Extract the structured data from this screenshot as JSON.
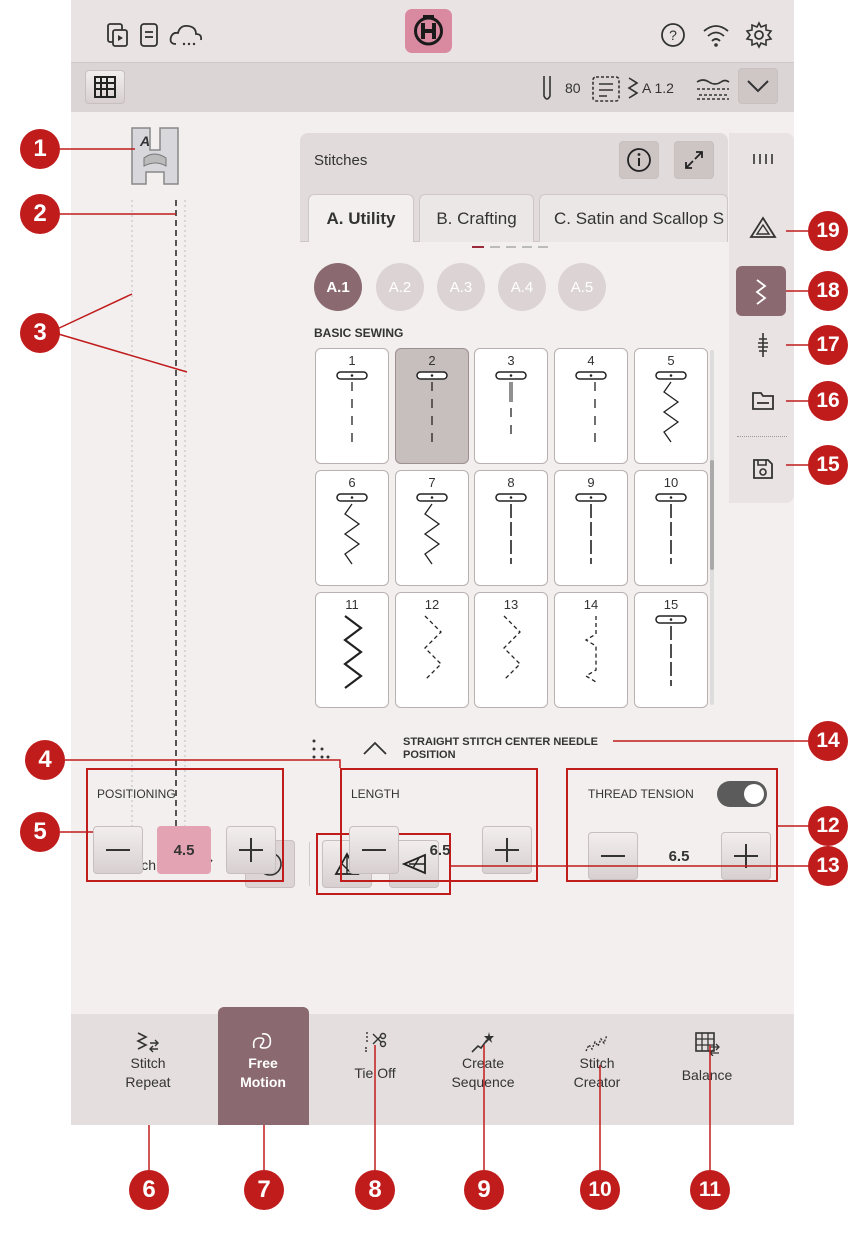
{
  "topbar": {
    "icons": [
      "sequence-icon",
      "guide-icon",
      "cloud-icon",
      "husqvarna-logo",
      "help-icon",
      "wifi-icon",
      "settings-icon"
    ]
  },
  "subbar": {
    "needle_value": "80",
    "stitch_code": "A 1.2"
  },
  "stitch_panel": {
    "title": "Stitches",
    "tabs": [
      "A. Utility",
      "B. Crafting",
      "C. Satin and Scallop S"
    ],
    "subcategories": [
      "A.1",
      "A.2",
      "A.3",
      "A.4",
      "A.5"
    ],
    "section_label": "BASIC SEWING",
    "stitches": [
      "1",
      "2",
      "3",
      "4",
      "5",
      "6",
      "7",
      "8",
      "9",
      "10",
      "11",
      "12",
      "13",
      "14",
      "15"
    ],
    "selected_stitch": "2",
    "description": "STRAIGHT STITCH CENTER NEEDLE POSITION"
  },
  "edit": {
    "label": "Edit Stitch"
  },
  "positioning": {
    "label": "POSITIONING",
    "value": "4.5"
  },
  "length": {
    "label": "LENGTH",
    "value": "6.5"
  },
  "thread_tension": {
    "label": "THREAD TENSION",
    "value": "6.5",
    "enabled": true
  },
  "bottom_bar": [
    {
      "l1": "Stitch",
      "l2": "Repeat"
    },
    {
      "l1": "Free",
      "l2": "Motion"
    },
    {
      "l1": "Tie Off",
      "l2": ""
    },
    {
      "l1": "Create",
      "l2": "Sequence"
    },
    {
      "l1": "Stitch",
      "l2": "Creator"
    },
    {
      "l1": "Balance",
      "l2": ""
    }
  ],
  "callouts": [
    "1",
    "2",
    "3",
    "4",
    "5",
    "6",
    "7",
    "8",
    "9",
    "10",
    "11",
    "12",
    "13",
    "14",
    "15",
    "16",
    "17",
    "18",
    "19"
  ],
  "colors": {
    "accent": "#c01c1c",
    "active": "#8a6a70",
    "highlight": "#e4a3b3"
  }
}
